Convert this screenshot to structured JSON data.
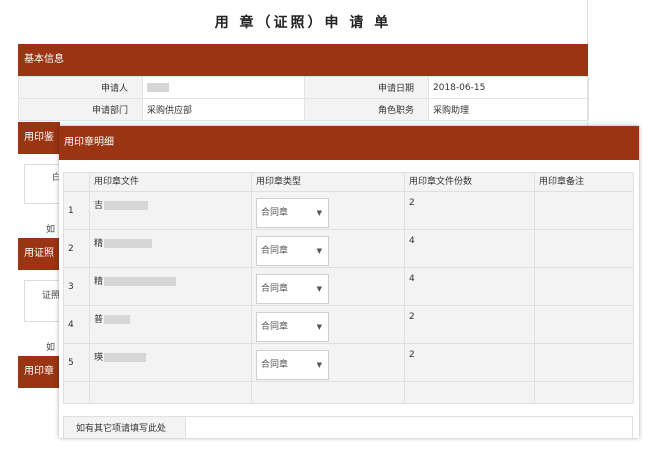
{
  "form": {
    "title": "用 章（证照）申 请 单",
    "basic_section": "基本信息",
    "applicant_label": "申请人",
    "date_label": "申请日期",
    "date_value": "2018-06-15",
    "dept_label": "申请部门",
    "dept_value": "采购供应部",
    "role_label": "角色职务",
    "role_value": "采购助理",
    "seal_section_partial": "用印鉴",
    "cert_section_partial": "用证照",
    "seal_section2_partial": "用印章",
    "frag_ru": "如",
    "frag_zheng": "证照",
    "frag_bai": "白"
  },
  "dialog": {
    "title": "用印章明细",
    "columns": [
      "用印章文件",
      "用印章类型",
      "用印章文件份数",
      "用印章备注"
    ],
    "rows": [
      {
        "index": "1",
        "file_char": "吉",
        "type": "合同章",
        "count": "2",
        "blur_w": 44
      },
      {
        "index": "2",
        "file_char": "精",
        "type": "合同章",
        "count": "4",
        "blur_w": 48
      },
      {
        "index": "3",
        "file_char": "精",
        "type": "合同章",
        "count": "4",
        "blur_w": 72
      },
      {
        "index": "4",
        "file_char": "普",
        "type": "合同章",
        "count": "2",
        "blur_w": 26
      },
      {
        "index": "5",
        "file_char": "瑛",
        "type": "合同章",
        "count": "2",
        "blur_w": 42
      }
    ],
    "note_label": "如有其它项请填写此处",
    "note_value": ""
  },
  "colors": {
    "header_bar": "#9a3412",
    "label_bg": "#f3f3f3"
  },
  "icons": {
    "select_arrow": "▼"
  }
}
